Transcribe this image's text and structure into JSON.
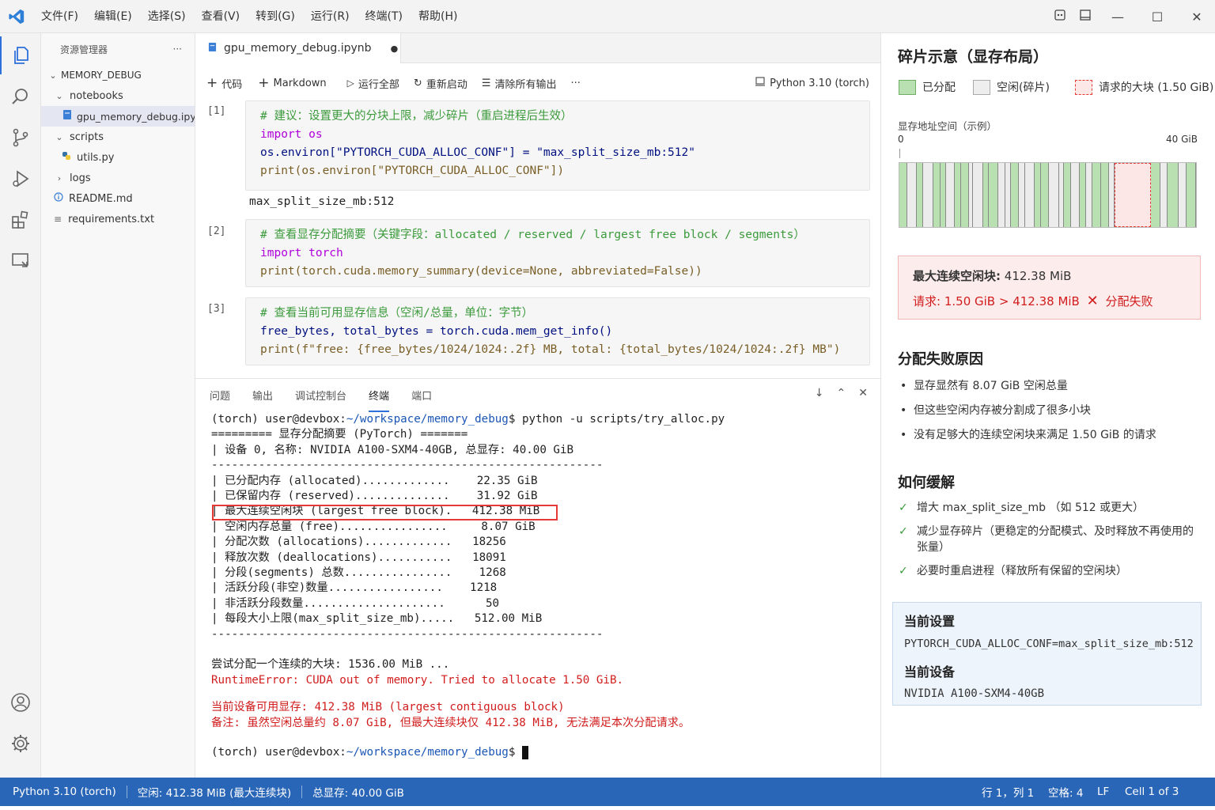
{
  "titlebar": {
    "menus": [
      "文件(F)",
      "编辑(E)",
      "选择(S)",
      "查看(V)",
      "转到(G)",
      "运行(R)",
      "终端(T)",
      "帮助(H)"
    ]
  },
  "sidebar": {
    "title": "资源管理器",
    "more": "···",
    "root": "MEMORY_DEBUG",
    "items": [
      {
        "label": "notebooks"
      },
      {
        "label": "gpu_memory_debug.ipynb"
      },
      {
        "label": "scripts"
      },
      {
        "label": "utils.py"
      },
      {
        "label": "logs"
      },
      {
        "label": "README.md"
      },
      {
        "label": "requirements.txt"
      }
    ]
  },
  "editor": {
    "tab": "gpu_memory_debug.ipynb",
    "tab_dirty": "●",
    "toolbar": {
      "code": "代码",
      "markdown": "Markdown",
      "run_all": "运行全部",
      "restart": "重新启动",
      "clear": "清除所有输出",
      "more": "···",
      "kernel": "Python 3.10 (torch)"
    },
    "cells": [
      {
        "no": "[1]",
        "lines": [
          "# 建议：设置更大的分块上限，减少碎片（重启进程后生效）",
          "import os",
          "os.environ[\"PYTORCH_CUDA_ALLOC_CONF\"] = \"max_split_size_mb:512\"",
          "print(os.environ[\"PYTORCH_CUDA_ALLOC_CONF\"])"
        ],
        "output": "max_split_size_mb:512"
      },
      {
        "no": "[2]",
        "lines": [
          "# 查看显存分配摘要（关键字段：allocated / reserved / largest free block / segments）",
          "import torch",
          "print(torch.cuda.memory_summary(device=None, abbreviated=False))"
        ]
      },
      {
        "no": "[3]",
        "lines": [
          "# 查看当前可用显存信息（空闲/总量，单位：字节）",
          "free_bytes, total_bytes = torch.cuda.mem_get_info()",
          "print(f\"free: {free_bytes/1024/1024:.2f} MB, total: {total_bytes/1024/1024:.2f} MB\")"
        ]
      }
    ]
  },
  "panel": {
    "tabs": [
      "问题",
      "输出",
      "调试控制台",
      "终端",
      "端口"
    ],
    "active_tab": "终端",
    "terminal": {
      "env": "(torch) ",
      "user_host": "user@devbox:",
      "path": "~/workspace/memory_debug",
      "prompt_tail": "$ ",
      "command": "python -u scripts/try_alloc.py",
      "summary_lines": [
        "========= 显存分配摘要 (PyTorch) =======",
        "| 设备 0, 名称: NVIDIA A100-SXM4-40GB, 总显存: 40.00 GiB",
        "----------------------------------------------------------",
        "| 已分配内存 (allocated).............    22.35 GiB",
        "| 已保留内存 (reserved)..............    31.92 GiB",
        "| 最大连续空闲块 (largest free block).   412.38 MiB",
        "| 空闲内存总量 (free)................     8.07 GiB",
        "| 分配次数 (allocations).............   18256",
        "| 释放次数 (deallocations)...........   18091",
        "| 分段(segments) 总数................    1268",
        "| 活跃分段(非空)数量.................    1218",
        "| 非活跃分段数量.....................      50",
        "| 每段大小上限(max_split_size_mb).....   512.00 MiB",
        "----------------------------------------------------------"
      ],
      "attempt": "尝试分配一个连续的大块: 1536.00 MiB ...",
      "error": "RuntimeError: CUDA out of memory. Tried to allocate 1.50 GiB.",
      "avail": "当前设备可用显存: 412.38 MiB (largest contiguous block)",
      "note": "备注: 虽然空闲总量约 8.07 GiB, 但最大连续块仅 412.38 MiB, 无法满足本次分配请求。"
    }
  },
  "right": {
    "title": "碎片示意（显存布局）",
    "legend": {
      "allocated": "已分配",
      "free": "空闲(碎片)",
      "request": "请求的大块 (1.50 GiB)"
    },
    "space_label": "显存地址空间（示例）",
    "axis_start": "0",
    "axis_end": "40 GiB",
    "error_box": {
      "line1_label": "最大连续空闲块:",
      "line1_value": "412.38 MiB",
      "line2_label": "请求:",
      "line2_value": "1.50 GiB > 412.38 MiB",
      "line2_fail": "分配失败"
    },
    "reasons_title": "分配失败原因",
    "reasons": [
      "显存显然有 8.07 GiB 空闲总量",
      "但这些空闲内存被分割成了很多小块",
      "没有足够大的连续空闲块来满足 1.50 GiB 的请求"
    ],
    "fix_title": "如何缓解",
    "fixes": [
      "增大 max_split_size_mb （如 512 或更大）",
      "减少显存碎片（更稳定的分配模式、及时释放不再使用的张量）",
      "必要时重启进程（释放所有保留的空闲块）"
    ],
    "current": {
      "setting_title": "当前设置",
      "setting_value": "PYTORCH_CUDA_ALLOC_CONF=max_split_size_mb:512",
      "device_title": "当前设备",
      "device_value": "NVIDIA A100-SXM4-40GB"
    }
  },
  "statusbar": {
    "kernel": "Python 3.10 (torch)",
    "free": "空闲: 412.38 MiB (最大连续块)",
    "total": "总显存: 40.00 GiB",
    "position": "行 1，列 1",
    "spaces": "空格: 4",
    "eol": "LF",
    "cell": "Cell 1 of 3"
  },
  "colors": {
    "accent": "#2d6fdb",
    "statusbar": "#2a66b8",
    "allocated": "#b9e0b0",
    "error": "#d11d1d"
  }
}
